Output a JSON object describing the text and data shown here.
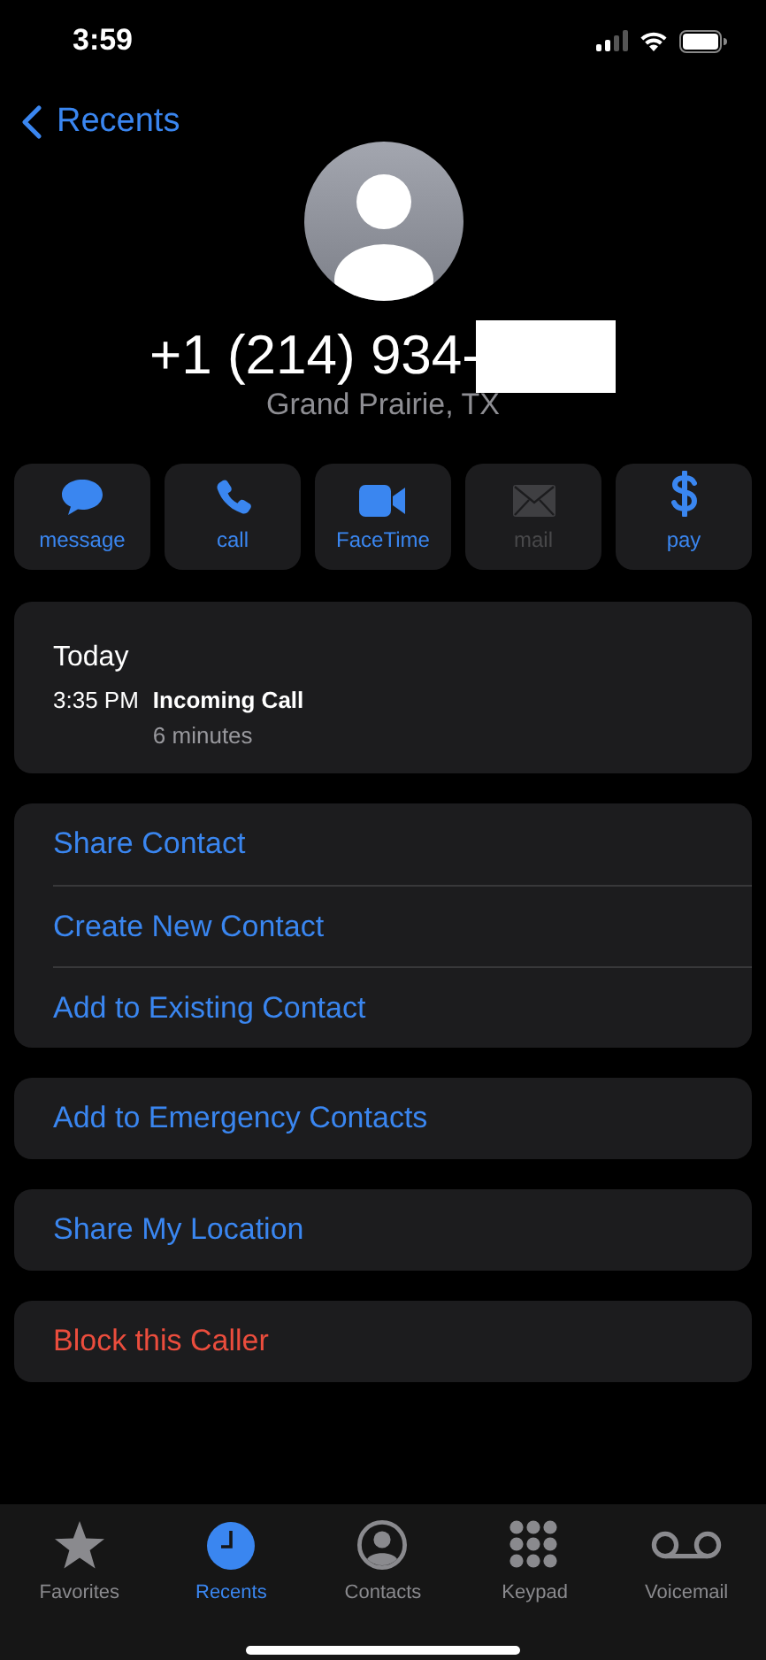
{
  "status_bar": {
    "time": "3:59"
  },
  "nav": {
    "back_label": "Recents"
  },
  "contact": {
    "number": "+1 (214) 934-",
    "location": "Grand Prairie, TX"
  },
  "actions": [
    {
      "kind": "message",
      "label": "message",
      "disabled": false
    },
    {
      "kind": "call",
      "label": "call",
      "disabled": false
    },
    {
      "kind": "video",
      "label": "FaceTime",
      "disabled": false
    },
    {
      "kind": "mail",
      "label": "mail",
      "disabled": true
    },
    {
      "kind": "pay",
      "label": "pay",
      "disabled": false
    }
  ],
  "call_log": {
    "day": "Today",
    "entries": [
      {
        "time": "3:35 PM",
        "type": "Incoming Call",
        "duration": "6 minutes"
      }
    ]
  },
  "option_groups": [
    {
      "items": [
        {
          "label": "Share Contact",
          "kind": "action"
        },
        {
          "label": "Create New Contact",
          "kind": "action"
        },
        {
          "label": "Add to Existing Contact",
          "kind": "action"
        }
      ]
    },
    {
      "items": [
        {
          "label": "Add to Emergency Contacts",
          "kind": "action"
        }
      ]
    },
    {
      "items": [
        {
          "label": "Share My Location",
          "kind": "action"
        }
      ]
    },
    {
      "items": [
        {
          "label": "Block this Caller",
          "kind": "destructive"
        }
      ]
    }
  ],
  "tabs": [
    {
      "kind": "favorites",
      "label": "Favorites",
      "selected": false
    },
    {
      "kind": "recents",
      "label": "Recents",
      "selected": true
    },
    {
      "kind": "contacts",
      "label": "Contacts",
      "selected": false
    },
    {
      "kind": "keypad",
      "label": "Keypad",
      "selected": false
    },
    {
      "kind": "voicemail",
      "label": "Voicemail",
      "selected": false
    }
  ]
}
